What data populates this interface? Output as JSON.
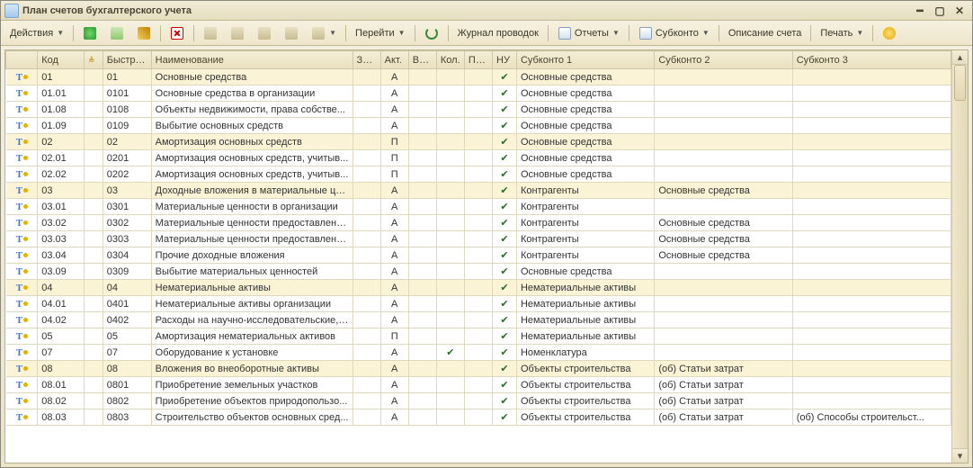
{
  "window": {
    "title": "План счетов бухгалтерского учета"
  },
  "toolbar": {
    "actions_label": "Действия",
    "goto_label": "Перейти",
    "journal_label": "Журнал проводок",
    "reports_label": "Отчеты",
    "subkonto_label": "Субконто",
    "descr_label": "Описание счета",
    "print_label": "Печать"
  },
  "columns": {
    "ticon": "",
    "code": "Код",
    "sort": "",
    "fast": "Быстрый...",
    "name": "Наименование",
    "zab": "Заб.",
    "act": "Акт.",
    "val": "Вал.",
    "kol": "Кол.",
    "po": "По...",
    "nu": "НУ",
    "s1": "Субконто 1",
    "s2": "Субконто 2",
    "s3": "Субконто 3"
  },
  "rows": [
    {
      "group": true,
      "code": "01",
      "fast": "01",
      "name": "Основные средства",
      "act": "А",
      "nu": true,
      "s1": "Основные средства",
      "s2": "",
      "s3": ""
    },
    {
      "group": false,
      "code": "01.01",
      "fast": "0101",
      "name": "Основные средства в организации",
      "act": "А",
      "nu": true,
      "s1": "Основные средства",
      "s2": "",
      "s3": ""
    },
    {
      "group": false,
      "code": "01.08",
      "fast": "0108",
      "name": "Объекты недвижимости, права собстве...",
      "act": "А",
      "nu": true,
      "s1": "Основные средства",
      "s2": "",
      "s3": ""
    },
    {
      "group": false,
      "code": "01.09",
      "fast": "0109",
      "name": "Выбытие основных средств",
      "act": "А",
      "nu": true,
      "s1": "Основные средства",
      "s2": "",
      "s3": ""
    },
    {
      "group": true,
      "code": "02",
      "fast": "02",
      "name": "Амортизация основных средств",
      "act": "П",
      "nu": true,
      "s1": "Основные средства",
      "s2": "",
      "s3": ""
    },
    {
      "group": false,
      "code": "02.01",
      "fast": "0201",
      "name": "Амортизация основных средств, учитыв...",
      "act": "П",
      "nu": true,
      "s1": "Основные средства",
      "s2": "",
      "s3": ""
    },
    {
      "group": false,
      "code": "02.02",
      "fast": "0202",
      "name": "Амортизация основных средств, учитыв...",
      "act": "П",
      "nu": true,
      "s1": "Основные средства",
      "s2": "",
      "s3": ""
    },
    {
      "group": true,
      "code": "03",
      "fast": "03",
      "name": "Доходные вложения в материальные це...",
      "act": "А",
      "nu": true,
      "s1": "Контрагенты",
      "s2": "Основные средства",
      "s3": ""
    },
    {
      "group": false,
      "code": "03.01",
      "fast": "0301",
      "name": "Материальные ценности в организации",
      "act": "А",
      "nu": true,
      "s1": "Контрагенты",
      "s2": "",
      "s3": ""
    },
    {
      "group": false,
      "code": "03.02",
      "fast": "0302",
      "name": "Материальные ценности предоставленн...",
      "act": "А",
      "nu": true,
      "s1": "Контрагенты",
      "s2": "Основные средства",
      "s3": ""
    },
    {
      "group": false,
      "code": "03.03",
      "fast": "0303",
      "name": "Материальные ценности предоставленн...",
      "act": "А",
      "nu": true,
      "s1": "Контрагенты",
      "s2": "Основные средства",
      "s3": ""
    },
    {
      "group": false,
      "code": "03.04",
      "fast": "0304",
      "name": "Прочие доходные вложения",
      "act": "А",
      "nu": true,
      "s1": "Контрагенты",
      "s2": "Основные средства",
      "s3": ""
    },
    {
      "group": false,
      "code": "03.09",
      "fast": "0309",
      "name": "Выбытие материальных ценностей",
      "act": "А",
      "nu": true,
      "s1": "Основные средства",
      "s2": "",
      "s3": ""
    },
    {
      "group": true,
      "code": "04",
      "fast": "04",
      "name": "Нематериальные активы",
      "act": "А",
      "nu": true,
      "s1": "Нематериальные активы",
      "s2": "",
      "s3": ""
    },
    {
      "group": false,
      "code": "04.01",
      "fast": "0401",
      "name": "Нематериальные активы организации",
      "act": "А",
      "nu": true,
      "s1": "Нематериальные активы",
      "s2": "",
      "s3": ""
    },
    {
      "group": false,
      "code": "04.02",
      "fast": "0402",
      "name": "Расходы на научно-исследовательские, ...",
      "act": "А",
      "nu": true,
      "s1": "Нематериальные активы",
      "s2": "",
      "s3": ""
    },
    {
      "group": false,
      "code": "05",
      "fast": "05",
      "name": "Амортизация нематериальных активов",
      "act": "П",
      "nu": true,
      "s1": "Нематериальные активы",
      "s2": "",
      "s3": ""
    },
    {
      "group": false,
      "code": "07",
      "fast": "07",
      "name": "Оборудование к установке",
      "act": "А",
      "kol": true,
      "nu": true,
      "s1": "Номенклатура",
      "s2": "",
      "s3": ""
    },
    {
      "group": true,
      "code": "08",
      "fast": "08",
      "name": "Вложения во внеоборотные активы",
      "act": "А",
      "nu": true,
      "s1": "Объекты строительства",
      "s2": "(об) Статьи затрат",
      "s3": ""
    },
    {
      "group": false,
      "code": "08.01",
      "fast": "0801",
      "name": "Приобретение земельных участков",
      "act": "А",
      "nu": true,
      "s1": "Объекты строительства",
      "s2": "(об) Статьи затрат",
      "s3": ""
    },
    {
      "group": false,
      "code": "08.02",
      "fast": "0802",
      "name": "Приобретение объектов природопользо...",
      "act": "А",
      "nu": true,
      "s1": "Объекты строительства",
      "s2": "(об) Статьи затрат",
      "s3": ""
    },
    {
      "group": false,
      "code": "08.03",
      "fast": "0803",
      "name": "Строительство объектов основных сред...",
      "act": "А",
      "nu": true,
      "s1": "Объекты строительства",
      "s2": "(об) Статьи затрат",
      "s3": "(об) Способы строительст..."
    }
  ]
}
